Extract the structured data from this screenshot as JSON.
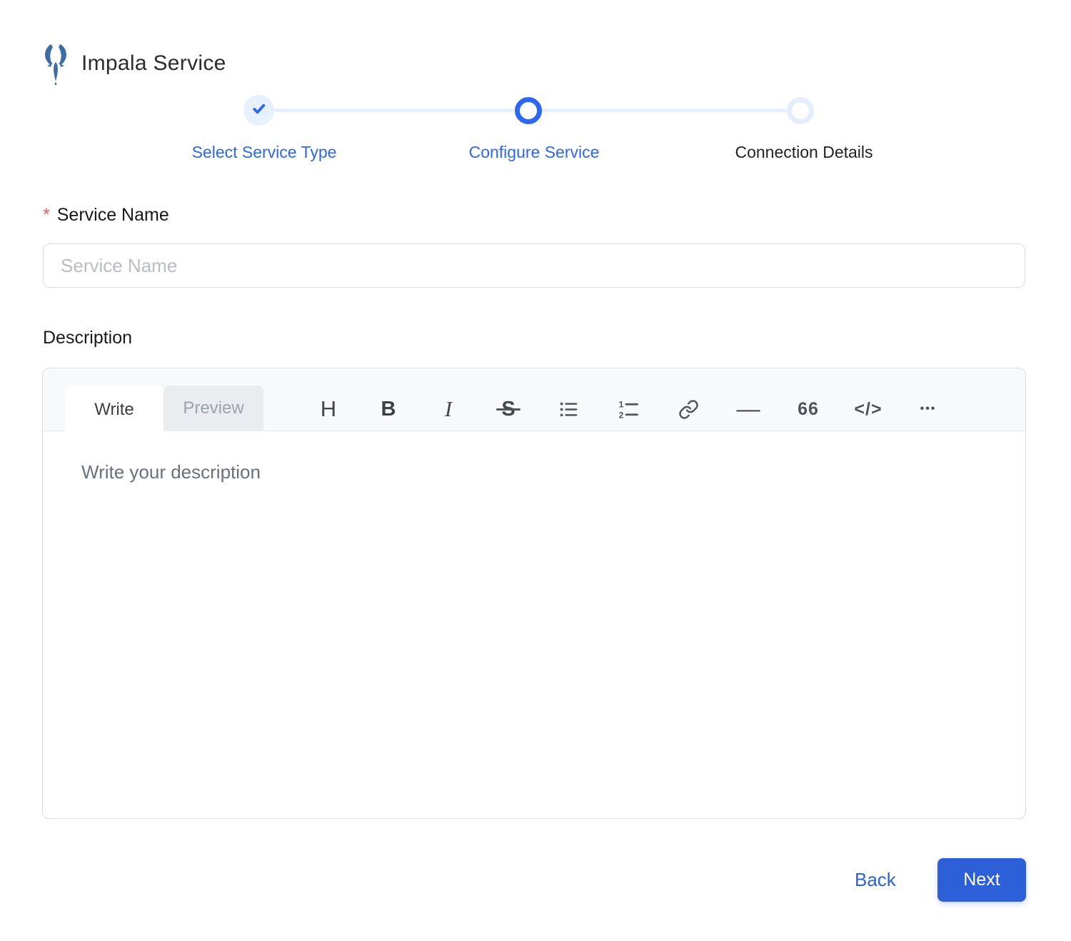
{
  "header": {
    "title": "Impala Service"
  },
  "stepper": {
    "steps": [
      {
        "label": "Select Service Type",
        "state": "completed"
      },
      {
        "label": "Configure Service",
        "state": "active"
      },
      {
        "label": "Connection Details",
        "state": "pending"
      }
    ]
  },
  "form": {
    "service_name": {
      "required_marker": "*",
      "label": "Service Name",
      "placeholder": "Service Name",
      "value": ""
    },
    "description": {
      "label": "Description",
      "placeholder": "Write your description",
      "value": ""
    }
  },
  "editor": {
    "tabs": [
      {
        "label": "Write",
        "active": true
      },
      {
        "label": "Preview",
        "active": false
      }
    ],
    "toolbar": [
      {
        "name": "heading-icon",
        "glyph": "H"
      },
      {
        "name": "bold-icon",
        "glyph": "B"
      },
      {
        "name": "italic-icon",
        "glyph": "I"
      },
      {
        "name": "strikethrough-icon",
        "glyph": "S"
      },
      {
        "name": "unordered-list-icon",
        "glyph": ""
      },
      {
        "name": "ordered-list-icon",
        "glyph": ""
      },
      {
        "name": "link-icon",
        "glyph": ""
      },
      {
        "name": "horizontal-rule-icon",
        "glyph": "—"
      },
      {
        "name": "quote-icon",
        "glyph": "66"
      },
      {
        "name": "code-icon",
        "glyph": "</>"
      },
      {
        "name": "more-icon",
        "glyph": "•••"
      }
    ]
  },
  "footer": {
    "back_label": "Back",
    "next_label": "Next"
  },
  "colors": {
    "accent_blue": "#2D68F3",
    "step_label_blue": "#2E66EE",
    "button_blue": "#2C5FD8",
    "back_link_blue": "#2B62DC",
    "required_red": "#E85D5D",
    "pending_ring": "#E3EDFB",
    "connector_line": "#E8EFFA",
    "completed_circle_bg": "#E7F0FD",
    "toolbar_icon": "#4F545B",
    "editor_header_bg": "#F8F9FB",
    "logo_blue": "#3E6CA6"
  }
}
